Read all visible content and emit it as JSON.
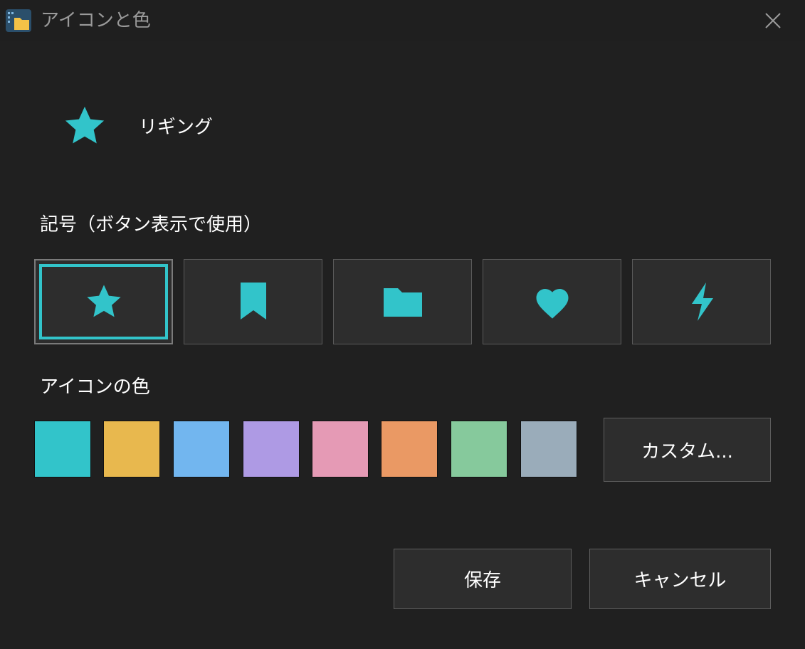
{
  "window": {
    "title": "アイコンと色",
    "app_icon": "folder-app-icon",
    "close_icon": "close-icon"
  },
  "preview": {
    "icon": "star-icon",
    "label": "リギング",
    "color": "#32c4ca"
  },
  "symbols": {
    "label": "記号（ボタン表示で使用）",
    "items": [
      {
        "icon": "star-icon",
        "selected": true
      },
      {
        "icon": "bookmark-icon",
        "selected": false
      },
      {
        "icon": "folder-icon",
        "selected": false
      },
      {
        "icon": "heart-icon",
        "selected": false
      },
      {
        "icon": "lightning-icon",
        "selected": false
      }
    ],
    "icon_color": "#32c4ca",
    "selection_color": "#32c4ca"
  },
  "colors": {
    "label": "アイコンの色",
    "swatches": [
      "#32c4ca",
      "#e8b84e",
      "#72b6ef",
      "#ae9ae4",
      "#e59ab5",
      "#ea9964",
      "#86c99c",
      "#9aacba"
    ],
    "custom_label": "カスタム..."
  },
  "actions": {
    "save_label": "保存",
    "cancel_label": "キャンセル"
  }
}
